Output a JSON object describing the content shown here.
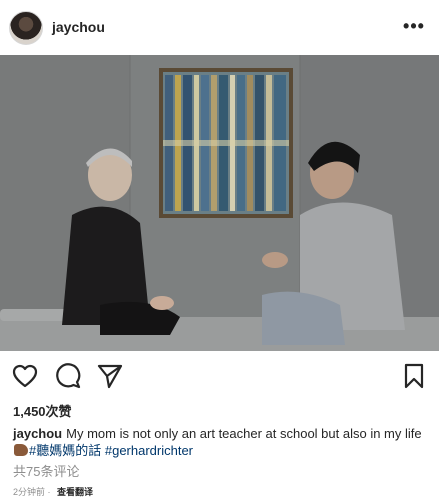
{
  "header": {
    "username": "jaychou",
    "more_icon": "more-horizontal-icon",
    "more_label": "•••"
  },
  "post": {
    "image_description_icon": "photo",
    "likes": "1,450次赞",
    "caption": {
      "username": "jaychou",
      "text": "My mom is not only an art teacher at school but also in my life",
      "emoji": "flexed-biceps-emoji",
      "hashtag_1": "#聽媽媽的話",
      "hashtag_2": "#gerhardrichter"
    },
    "comments_link": "共75条评论",
    "timestamp": "2分钟前",
    "separator": "·",
    "see_translation": "查看翻译"
  },
  "actions": {
    "like_icon": "heart-icon",
    "comment_icon": "comment-icon",
    "share_icon": "send-icon",
    "save_icon": "bookmark-icon"
  },
  "colors": {
    "text": "#262626",
    "muted": "#8e8e8e",
    "link": "#00376b",
    "wall": "#7b7d7d"
  }
}
